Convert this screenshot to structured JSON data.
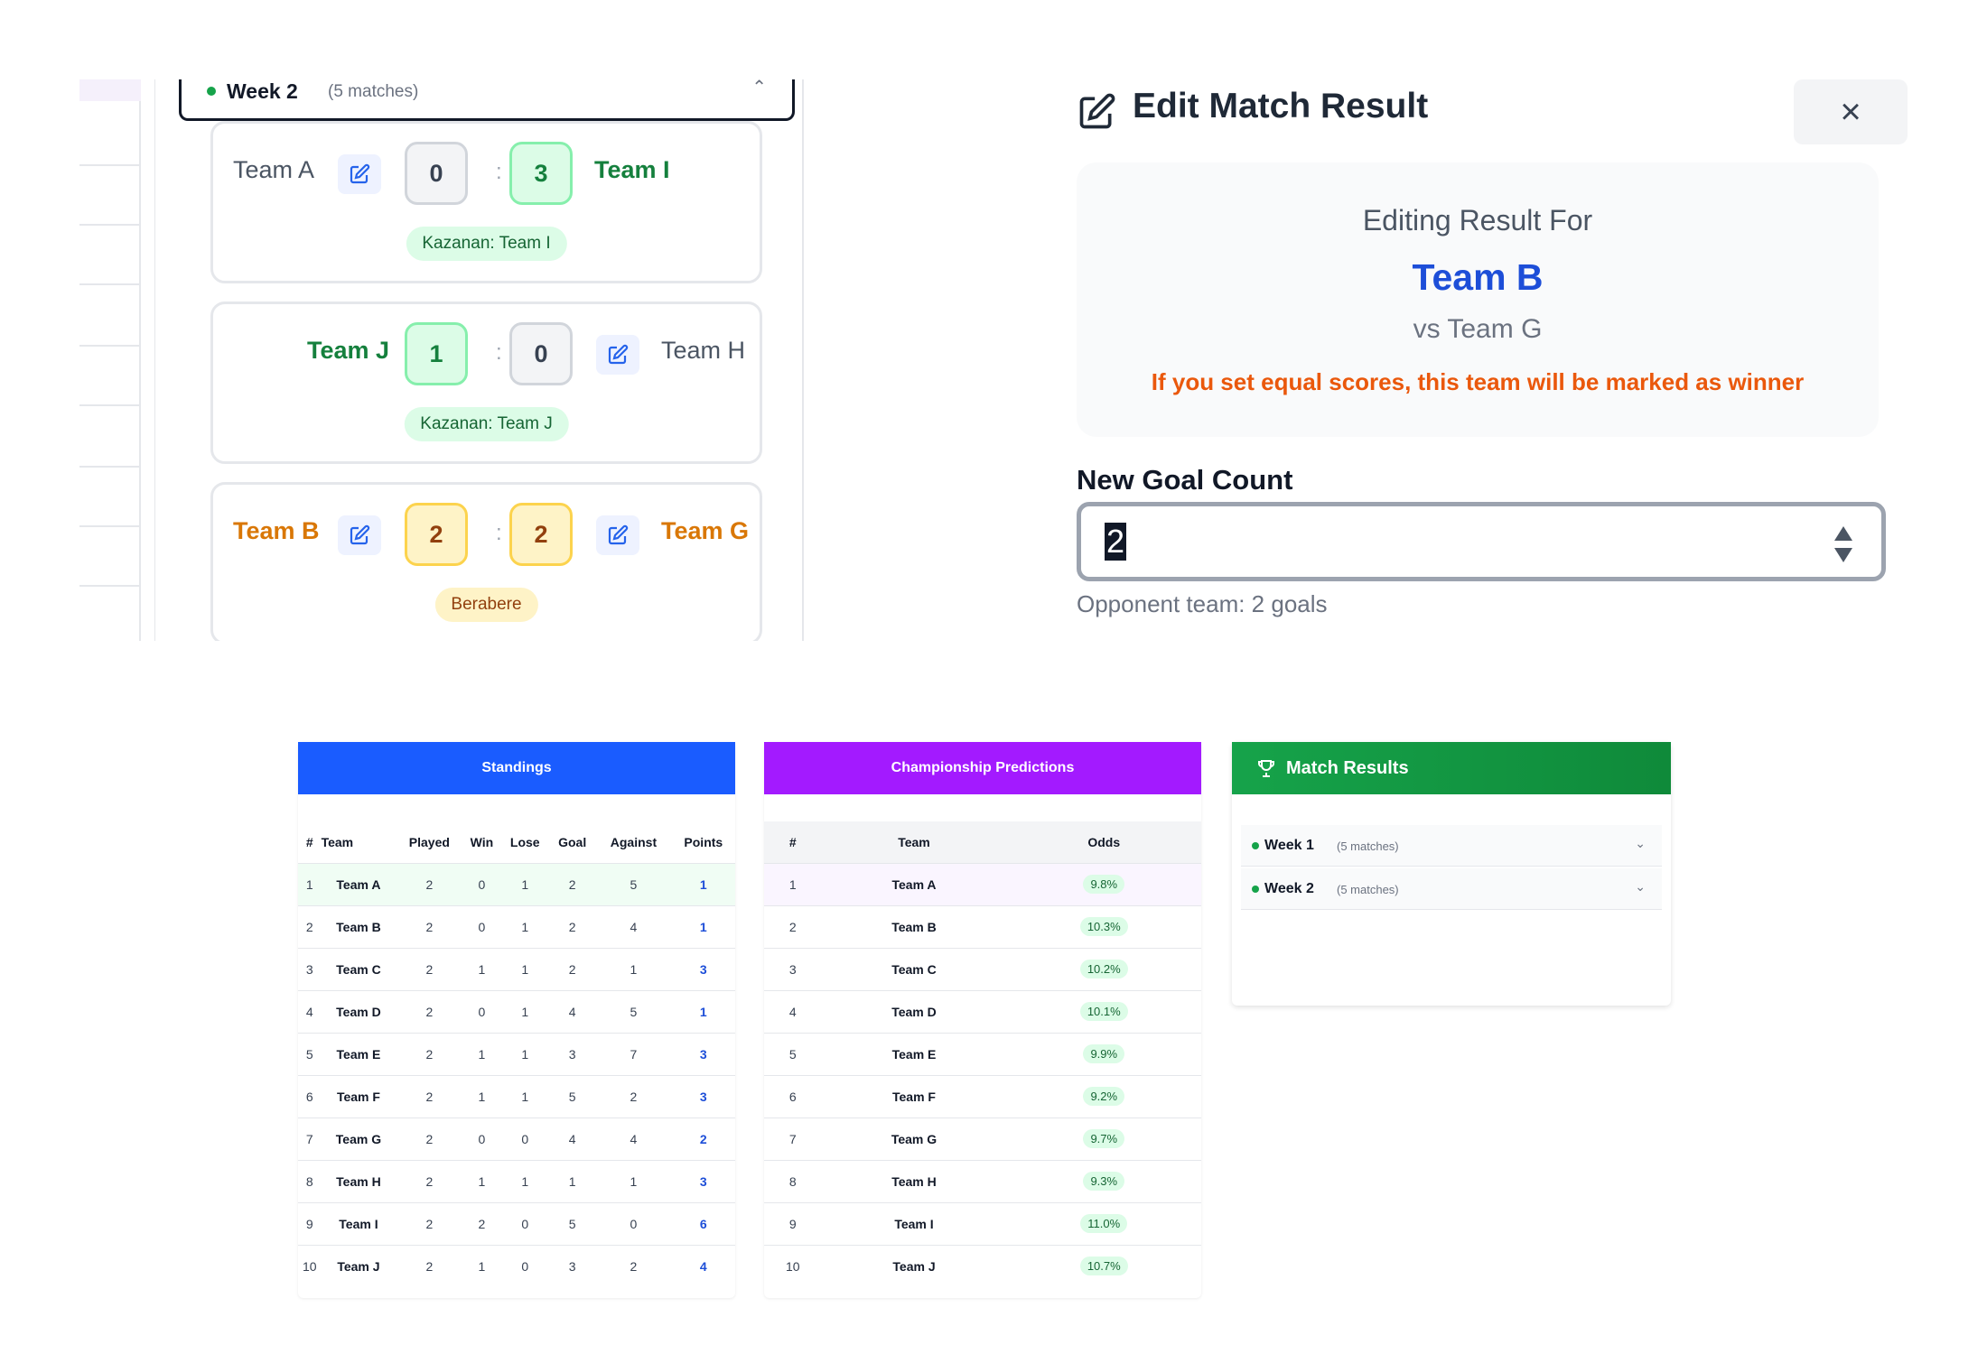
{
  "week_panel": {
    "title": "Week 2",
    "count": "(5 matches)",
    "matches": [
      {
        "home": "Team A",
        "away": "Team I",
        "home_score": "0",
        "away_score": "3",
        "badge": "Kazanan: Team I"
      },
      {
        "home": "Team J",
        "away": "Team H",
        "home_score": "1",
        "away_score": "0",
        "badge": "Kazanan: Team J"
      },
      {
        "home": "Team B",
        "away": "Team G",
        "home_score": "2",
        "away_score": "2",
        "badge": "Berabere"
      }
    ],
    "separator": ":"
  },
  "modal": {
    "title": "Edit Match Result",
    "close_label": "×",
    "editing_label": "Editing Result For",
    "team": "Team B",
    "opponent": "vs Team G",
    "warning": "If you set equal scores, this team will be marked as winner",
    "field_label": "New Goal Count",
    "field_value": "2",
    "hint": "Opponent team: 2 goals"
  },
  "standings": {
    "title": "Standings",
    "columns": [
      "#",
      "Team",
      "Played",
      "Win",
      "Lose",
      "Goal",
      "Against",
      "Points"
    ],
    "rows": [
      [
        "1",
        "Team A",
        "2",
        "0",
        "1",
        "2",
        "5",
        "1"
      ],
      [
        "2",
        "Team B",
        "2",
        "0",
        "1",
        "2",
        "4",
        "1"
      ],
      [
        "3",
        "Team C",
        "2",
        "1",
        "1",
        "2",
        "1",
        "3"
      ],
      [
        "4",
        "Team D",
        "2",
        "0",
        "1",
        "4",
        "5",
        "1"
      ],
      [
        "5",
        "Team E",
        "2",
        "1",
        "1",
        "3",
        "7",
        "3"
      ],
      [
        "6",
        "Team F",
        "2",
        "1",
        "1",
        "5",
        "2",
        "3"
      ],
      [
        "7",
        "Team G",
        "2",
        "0",
        "0",
        "4",
        "4",
        "2"
      ],
      [
        "8",
        "Team H",
        "2",
        "1",
        "1",
        "1",
        "1",
        "3"
      ],
      [
        "9",
        "Team I",
        "2",
        "2",
        "0",
        "5",
        "0",
        "6"
      ],
      [
        "10",
        "Team J",
        "2",
        "1",
        "0",
        "3",
        "2",
        "4"
      ]
    ],
    "color": "#1a5cff"
  },
  "predictions": {
    "title": "Championship Predictions",
    "columns": [
      "#",
      "Team",
      "Odds"
    ],
    "rows": [
      [
        "1",
        "Team A",
        "9.8%"
      ],
      [
        "2",
        "Team B",
        "10.3%"
      ],
      [
        "3",
        "Team C",
        "10.2%"
      ],
      [
        "4",
        "Team D",
        "10.1%"
      ],
      [
        "5",
        "Team E",
        "9.9%"
      ],
      [
        "6",
        "Team F",
        "9.2%"
      ],
      [
        "7",
        "Team G",
        "9.7%"
      ],
      [
        "8",
        "Team H",
        "9.3%"
      ],
      [
        "9",
        "Team I",
        "11.0%"
      ],
      [
        "10",
        "Team J",
        "10.7%"
      ]
    ],
    "color": "#a31aff"
  },
  "match_results": {
    "title": "Match Results",
    "weeks": [
      {
        "label": "Week 1",
        "count": "(5 matches)"
      },
      {
        "label": "Week 2",
        "count": "(5 matches)"
      }
    ],
    "color": "#16a34a"
  }
}
